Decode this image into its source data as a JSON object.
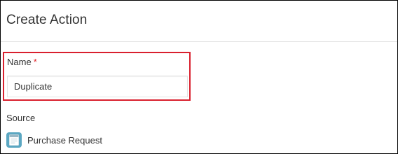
{
  "dialog": {
    "title": "Create Action"
  },
  "name_field": {
    "label": "Name",
    "required_mark": "*",
    "value": "Duplicate"
  },
  "source": {
    "label": "Source",
    "app_name": "Purchase Request",
    "app_icon": "app-form-icon"
  },
  "colors": {
    "highlight": "#d9202e",
    "required": "#e0292e",
    "app_icon_bg": "#5ba7c2"
  }
}
